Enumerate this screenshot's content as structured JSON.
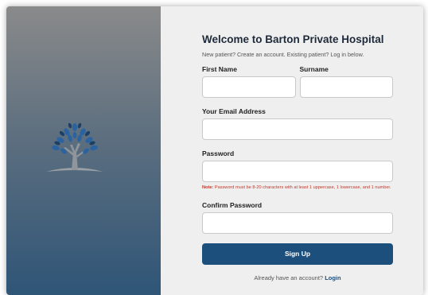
{
  "colors": {
    "accent": "#1d4f7c",
    "panel_top": "#8a8a8a",
    "panel_bottom": "#2f5577",
    "note_red": "#c0392b",
    "form_bg": "#efefef"
  },
  "logo": {
    "icon": "tree-logo-icon"
  },
  "form": {
    "title": "Welcome to Barton Private Hospital",
    "subtitle": "New patient? Create an account. Existing patient? Log in below.",
    "first_name_label": "First Name",
    "first_name_value": "",
    "surname_label": "Surname",
    "surname_value": "",
    "email_label": "Your Email Address",
    "email_value": "",
    "password_label": "Password",
    "password_value": "",
    "note_prefix": "Note:",
    "note_text": " Password must be 8-20 characters with at least 1 uppercase, 1 lowercase, and 1 number.",
    "confirm_label": "Confirm Password",
    "confirm_value": "",
    "signup_label": "Sign Up",
    "login_prompt": "Already have an account? ",
    "login_link": "Login"
  }
}
